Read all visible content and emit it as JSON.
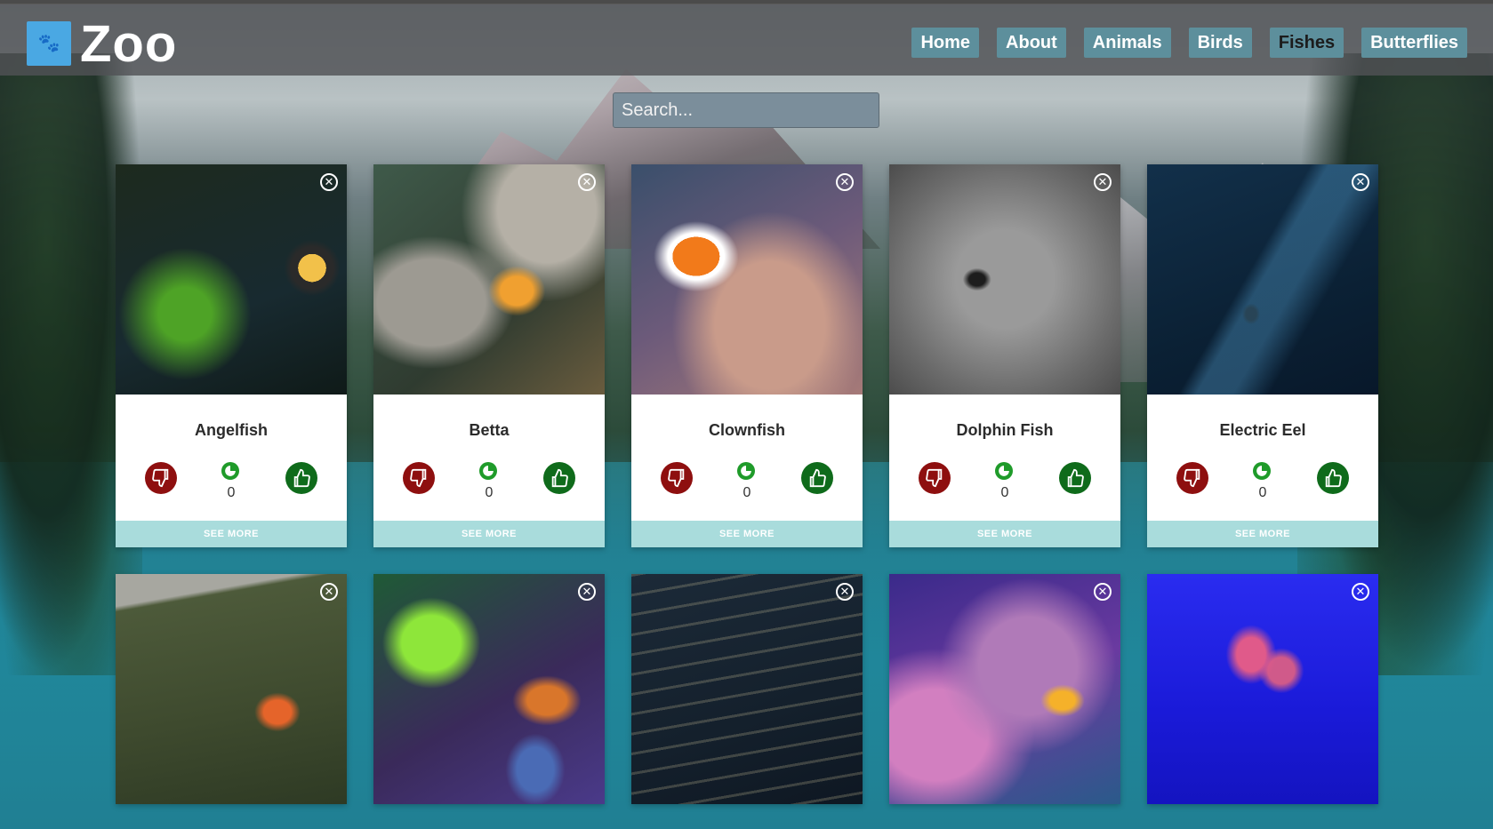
{
  "header": {
    "brand": "Zoo",
    "logo_icon": "paw-icon",
    "logo_color": "#4aa8e3",
    "nav_items": [
      {
        "label": "Home",
        "active": false
      },
      {
        "label": "About",
        "active": false
      },
      {
        "label": "Animals",
        "active": false
      },
      {
        "label": "Birds",
        "active": false
      },
      {
        "label": "Fishes",
        "active": true
      },
      {
        "label": "Butterflies",
        "active": false
      }
    ],
    "nav_color": "#5d8f9c"
  },
  "search": {
    "placeholder": "Search...",
    "value": ""
  },
  "cards": [
    {
      "name": "Angelfish",
      "score": "0",
      "see_more": "SEE MORE"
    },
    {
      "name": "Betta",
      "score": "0",
      "see_more": "SEE MORE"
    },
    {
      "name": "Clownfish",
      "score": "0",
      "see_more": "SEE MORE"
    },
    {
      "name": "Dolphin Fish",
      "score": "0",
      "see_more": "SEE MORE"
    },
    {
      "name": "Electric Eel",
      "score": "0",
      "see_more": "SEE MORE"
    },
    {
      "name": "",
      "score": "",
      "see_more": ""
    },
    {
      "name": "",
      "score": "",
      "see_more": ""
    },
    {
      "name": "",
      "score": "",
      "see_more": ""
    },
    {
      "name": "",
      "score": "",
      "see_more": ""
    },
    {
      "name": "",
      "score": "",
      "see_more": ""
    }
  ],
  "colors": {
    "dislike": "#8e0f0f",
    "like": "#0f6b1b",
    "see_more": "#a9dcdc"
  },
  "icons": {
    "close": "close-circle-icon",
    "dislike": "thumbs-down-icon",
    "like": "thumbs-up-icon",
    "score": "score-icon"
  }
}
